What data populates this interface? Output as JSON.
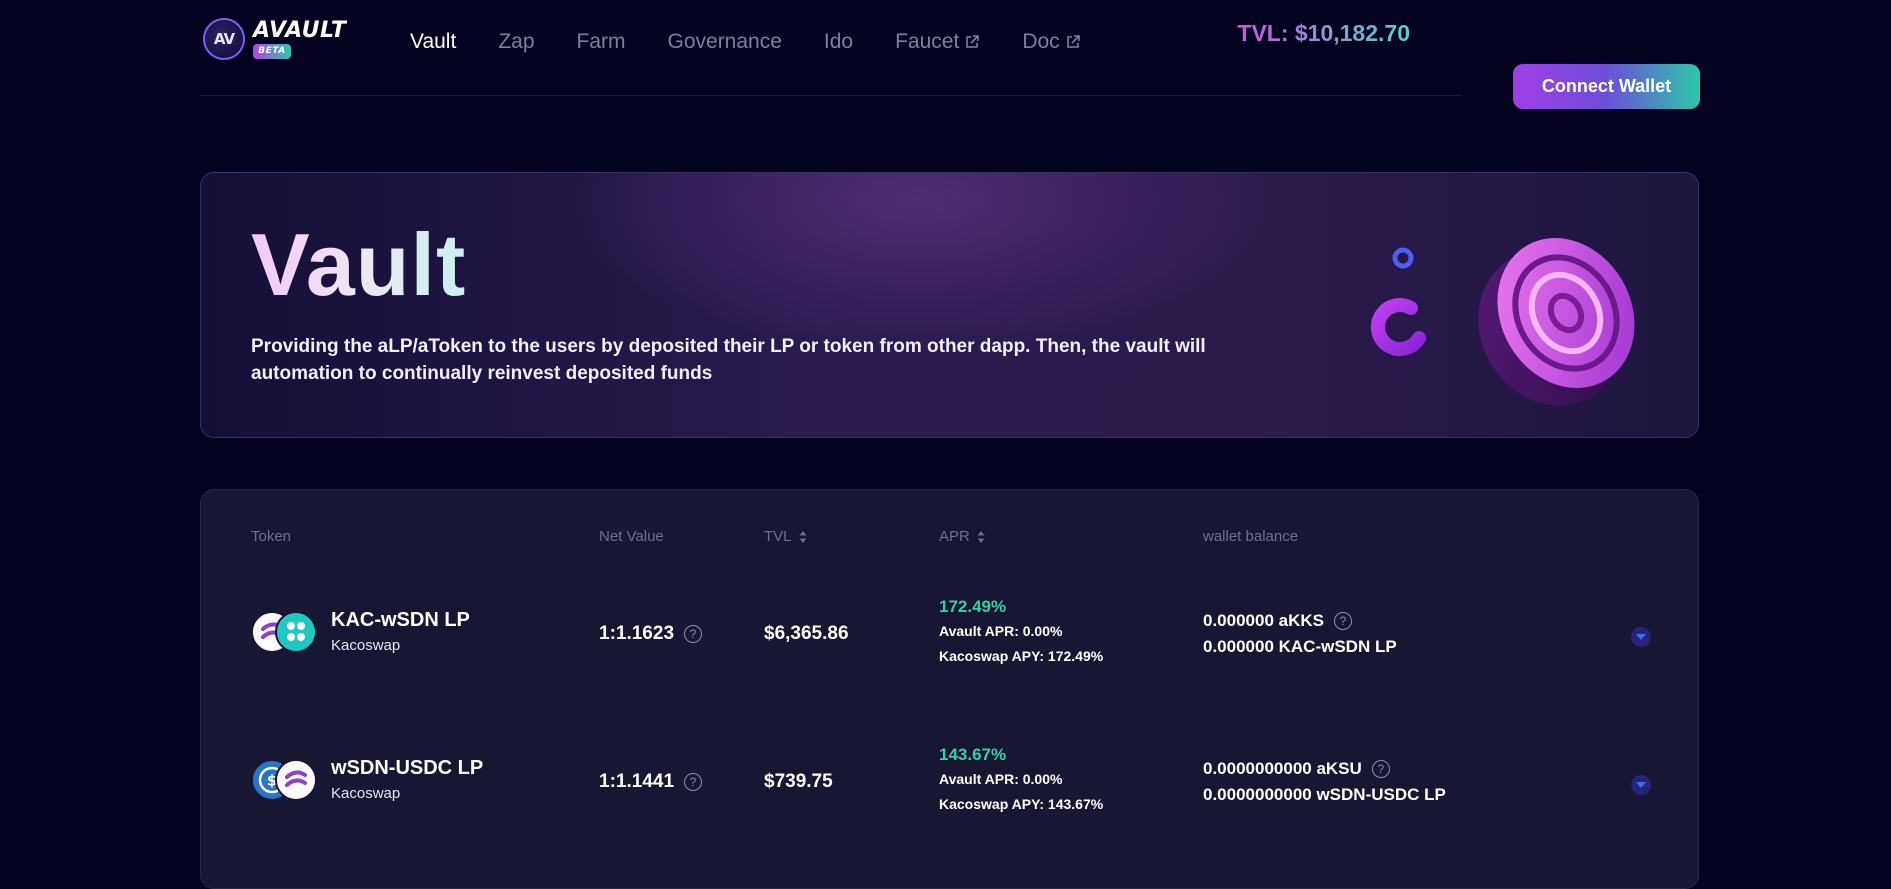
{
  "header": {
    "logo_text": "AVAULT",
    "logo_badge": "BETA",
    "logo_mark_icon": "avault-logo-icon",
    "nav": [
      {
        "label": "Vault",
        "active": true
      },
      {
        "label": "Zap"
      },
      {
        "label": "Farm"
      },
      {
        "label": "Governance"
      },
      {
        "label": "Ido"
      },
      {
        "label": "Faucet",
        "external": true,
        "icon": "external-link-icon"
      },
      {
        "label": "Doc",
        "external": true,
        "icon": "external-link-icon"
      }
    ],
    "tvl": "TVL: $10,182.70",
    "connect_label": "Connect Wallet"
  },
  "hero": {
    "title": "Vault",
    "description": "Providing the aLP/aToken to the users by deposited their LP or token from other dapp. Then, the vault will automation to continually reinvest deposited funds",
    "art_icon": "vault-coin-illustration"
  },
  "table": {
    "columns": {
      "token": "Token",
      "net_value": "Net Value",
      "tvl": "TVL",
      "apr": "APR",
      "wallet_balance": "wallet balance"
    },
    "rows": [
      {
        "name": "KAC-wSDN LP",
        "source": "Kacoswap",
        "net_value": "1:1.1623",
        "tvl": "$6,365.86",
        "apr": "172.49%",
        "avault_apr": "Avault APR: 0.00%",
        "source_apy": "Kacoswap APY: 172.49%",
        "balance_a": "0.000000 aKKS",
        "balance_lp": "0.000000 KAC-wSDN LP"
      },
      {
        "name": "wSDN-USDC LP",
        "source": "Kacoswap",
        "net_value": "1:1.1441",
        "tvl": "$739.75",
        "apr": "143.67%",
        "avault_apr": "Avault APR: 0.00%",
        "source_apy": "Kacoswap APY: 143.67%",
        "balance_a": "0.0000000000 aKSU",
        "balance_lp": "0.0000000000 wSDN-USDC LP"
      }
    ]
  },
  "colors": {
    "background": "#04031f",
    "accent_purple": "#a13ee6",
    "accent_teal": "#2bc9a8",
    "apr_green": "#35d0a8"
  }
}
